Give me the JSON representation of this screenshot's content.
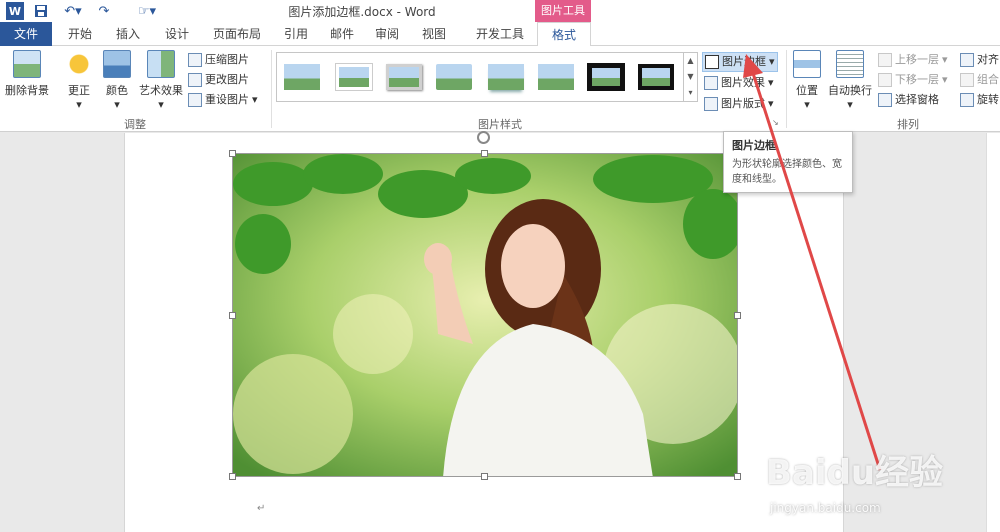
{
  "titlebar": {
    "title": "图片添加边框.docx - Word",
    "context_tab": "图片工具"
  },
  "tabs": [
    "文件",
    "开始",
    "插入",
    "设计",
    "页面布局",
    "引用",
    "邮件",
    "审阅",
    "视图",
    "开发工具",
    "格式"
  ],
  "ribbon": {
    "adjust": {
      "remove_bg": "删除背景",
      "correct": "更正",
      "color": "颜色",
      "art_effect": "艺术效果",
      "compress": "压缩图片",
      "change": "更改图片",
      "reset": "重设图片",
      "label": "调整"
    },
    "styles": {
      "label": "图片样式",
      "border": "图片边框",
      "effects": "图片效果",
      "layout": "图片版式"
    },
    "arrange": {
      "position": "位置",
      "wrap": "自动换行",
      "bring_forward": "上移一层",
      "send_backward": "下移一层",
      "selection_pane": "选择窗格",
      "align": "对齐",
      "group": "组合",
      "rotate": "旋转",
      "label": "排列"
    }
  },
  "tooltip": {
    "title": "图片边框",
    "description": "为形状轮廓选择颜色、宽度和线型。"
  },
  "watermark": {
    "brand": "Baidu经验",
    "url": "jingyan.baidu.com"
  },
  "colors": {
    "word_blue": "#2b579a",
    "context_pink": "#e35b8a",
    "arrow_red": "#e04848",
    "highlight": "#cde0f5"
  }
}
